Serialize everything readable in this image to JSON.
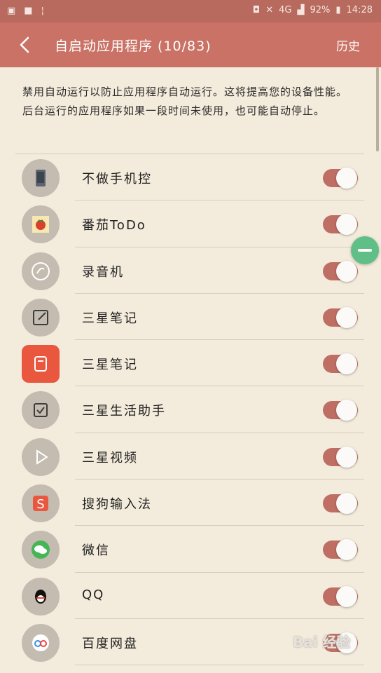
{
  "status_bar": {
    "signal": "4G",
    "battery": "92%",
    "time": "14:28"
  },
  "header": {
    "title": "自启动应用程序 (10/83)",
    "history": "历史"
  },
  "description": "禁用自动运行以防止应用程序自动运行。这将提高您的设备性能。后台运行的应用程序如果一段时间未使用，也可能自动停止。",
  "apps": [
    {
      "name": "不做手机控",
      "enabled": true,
      "icon": "phone-icon"
    },
    {
      "name": "番茄ToDo",
      "enabled": true,
      "icon": "tomato-icon"
    },
    {
      "name": "录音机",
      "enabled": true,
      "icon": "recorder-icon"
    },
    {
      "name": "三星笔记",
      "enabled": true,
      "icon": "note-icon"
    },
    {
      "name": "三星笔记",
      "enabled": true,
      "icon": "notebook-icon"
    },
    {
      "name": "三星生活助手",
      "enabled": true,
      "icon": "checkbox-icon"
    },
    {
      "name": "三星视频",
      "enabled": true,
      "icon": "play-icon"
    },
    {
      "name": "搜狗输入法",
      "enabled": true,
      "icon": "sogou-icon"
    },
    {
      "name": "微信",
      "enabled": true,
      "icon": "wechat-icon"
    },
    {
      "name": "QQ",
      "enabled": true,
      "icon": "qq-icon"
    },
    {
      "name": "百度网盘",
      "enabled": true,
      "icon": "cloud-drive-icon"
    }
  ],
  "watermark": "Bai 经验"
}
